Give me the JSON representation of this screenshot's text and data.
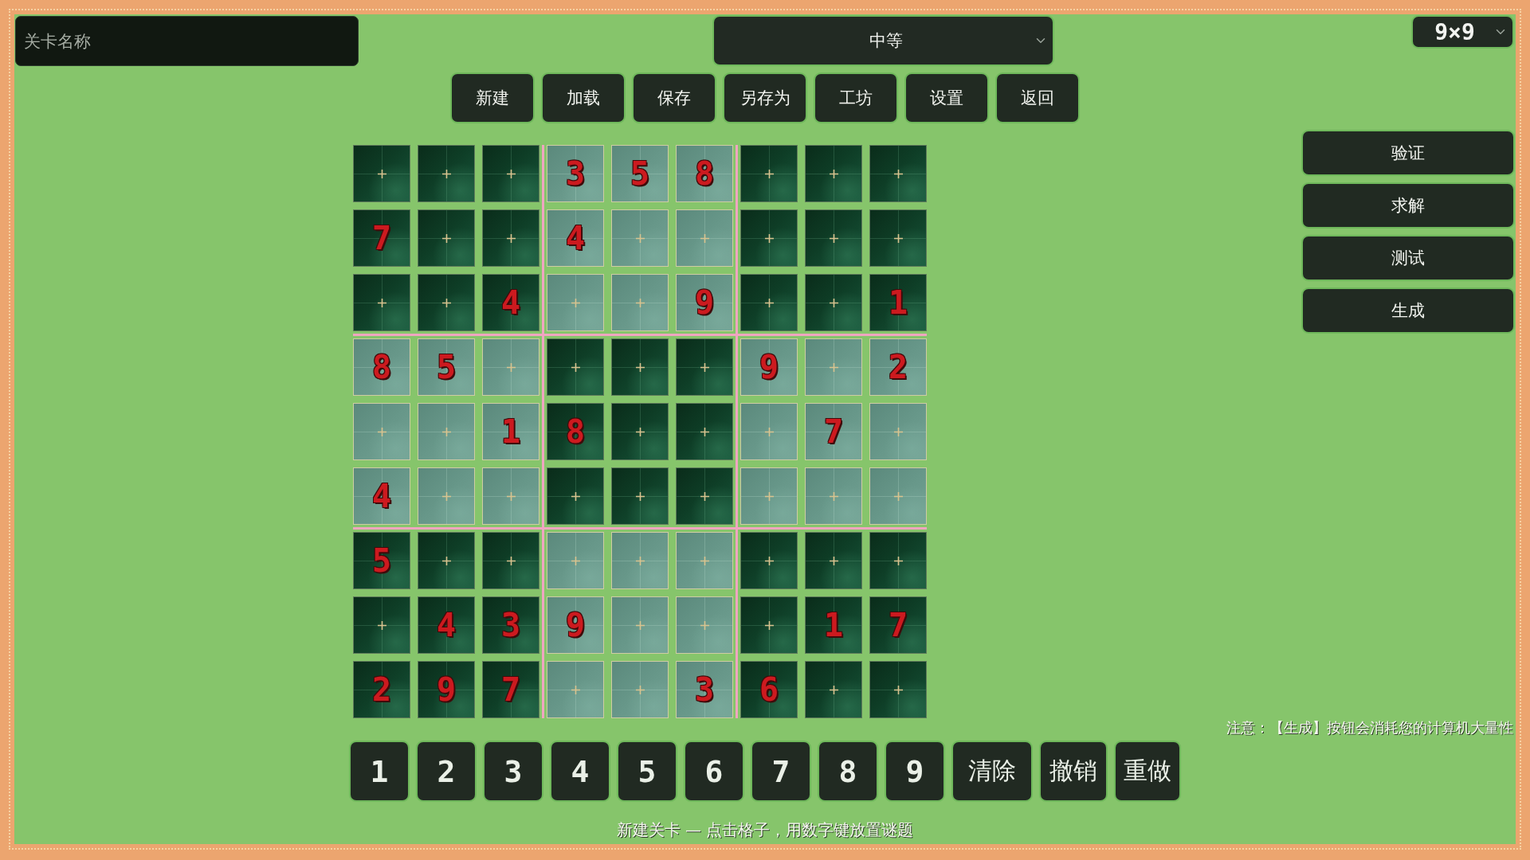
{
  "level_name": {
    "placeholder": "关卡名称"
  },
  "difficulty": {
    "value": "中等"
  },
  "grid_size": {
    "value": "9×9"
  },
  "toolbar": [
    "新建",
    "加载",
    "保存",
    "另存为",
    "工坊",
    "设置",
    "返回"
  ],
  "board": {
    "rows": [
      [
        null,
        null,
        null,
        "3",
        "5",
        "8",
        null,
        null,
        null
      ],
      [
        "7",
        null,
        null,
        "4",
        null,
        null,
        null,
        null,
        null
      ],
      [
        null,
        null,
        "4",
        null,
        null,
        "9",
        null,
        null,
        "1"
      ],
      [
        "8",
        "5",
        null,
        null,
        null,
        null,
        "9",
        null,
        "2"
      ],
      [
        null,
        null,
        "1",
        "8",
        null,
        null,
        null,
        "7",
        null
      ],
      [
        "4",
        null,
        null,
        null,
        null,
        null,
        null,
        null,
        null
      ],
      [
        "5",
        null,
        null,
        null,
        null,
        null,
        null,
        null,
        null
      ],
      [
        null,
        "4",
        "3",
        "9",
        null,
        null,
        null,
        "1",
        "7"
      ],
      [
        "2",
        "9",
        "7",
        null,
        null,
        "3",
        "6",
        null,
        null
      ]
    ]
  },
  "side_actions": [
    "验证",
    "求解",
    "测试",
    "生成"
  ],
  "note": "注意：【生成】按钮会消耗您的计算机大量性",
  "number_pad": {
    "digits": [
      "1",
      "2",
      "3",
      "4",
      "5",
      "6",
      "7",
      "8",
      "9"
    ],
    "actions": [
      "清除",
      "撤销",
      "重做"
    ]
  },
  "status_bar": "新建关卡 — 点击格子，用数字键放置谜题"
}
